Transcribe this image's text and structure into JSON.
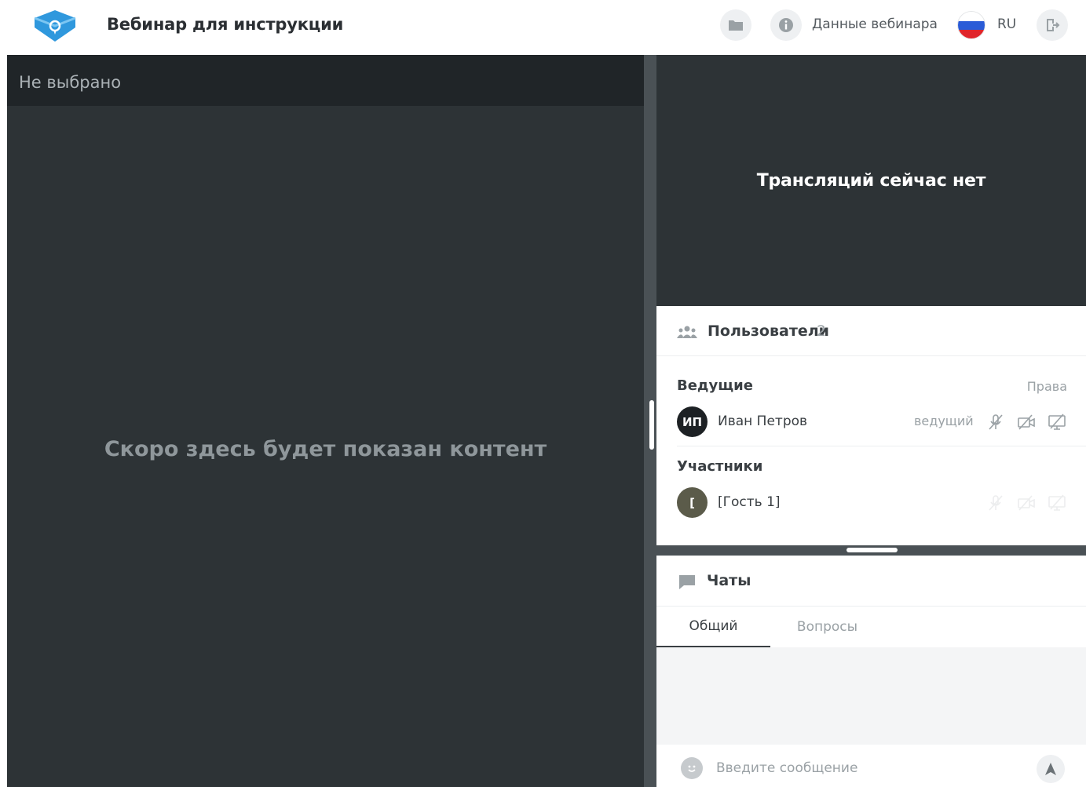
{
  "header": {
    "title": "Вебинар для инструкции",
    "webinar_data_label": "Данные вебинара",
    "language": "RU",
    "icons": {
      "logo": "app-logo",
      "folder": "folder-icon",
      "info": "info-icon",
      "flag": "russia-flag-icon",
      "exit": "exit-icon"
    }
  },
  "content": {
    "selection_label": "Не выбрано",
    "placeholder": "Скоро здесь будет показан контент"
  },
  "broadcast": {
    "status": "Трансляций сейчас нет"
  },
  "users": {
    "title": "Пользователи",
    "count": "2",
    "hosts_section": "Ведущие",
    "rights_label": "Права",
    "hosts": [
      {
        "initials": "ИП",
        "name": "Иван Петров",
        "role": "ведущий"
      }
    ],
    "participants_section": "Участники",
    "participants": [
      {
        "initials": "[",
        "name": "[Гость 1]"
      }
    ]
  },
  "chats": {
    "title": "Чаты",
    "tabs": [
      {
        "label": "Общий",
        "active": true
      },
      {
        "label": "Вопросы",
        "active": false
      }
    ],
    "input_placeholder": "Введите сообщение"
  },
  "colors": {
    "dark_bg": "#2d3336",
    "header_dark": "#202528",
    "logo_blue": "#3aa0e0",
    "flag_blue": "#2a5bd7",
    "flag_red": "#e0242a"
  }
}
